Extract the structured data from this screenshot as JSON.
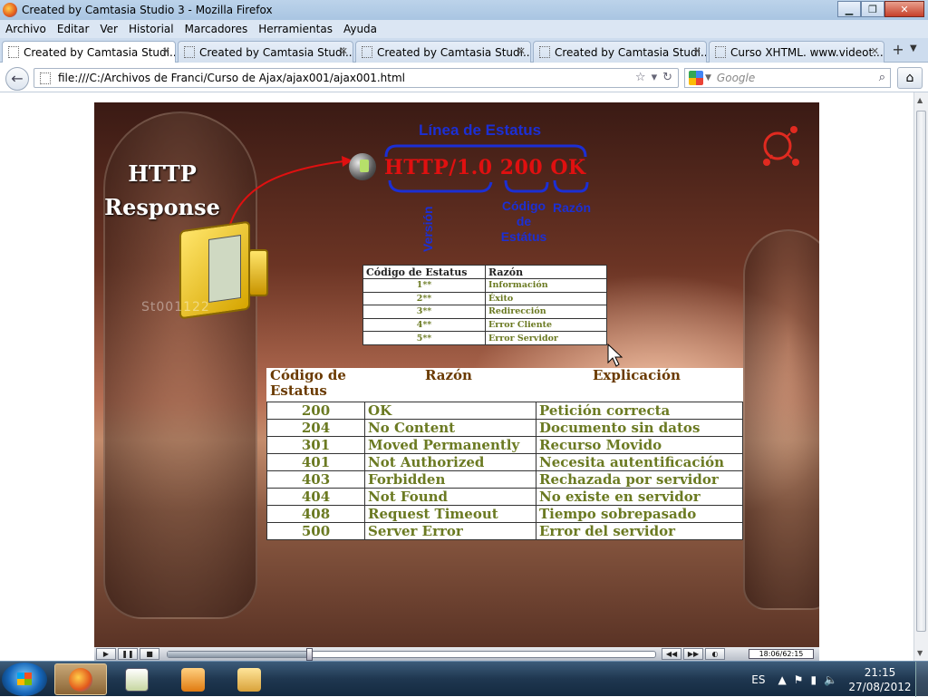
{
  "window": {
    "title": "Created by Camtasia Studio 3 - Mozilla Firefox",
    "minimize": "▁",
    "maximize": "❐",
    "close": "✕"
  },
  "menu": [
    "Archivo",
    "Editar",
    "Ver",
    "Historial",
    "Marcadores",
    "Herramientas",
    "Ayuda"
  ],
  "tabs": [
    {
      "label": "Created by Camtasia Studi...",
      "active": true
    },
    {
      "label": "Created by Camtasia Studi...",
      "active": false
    },
    {
      "label": "Created by Camtasia Studi...",
      "active": false
    },
    {
      "label": "Created by Camtasia Studi...",
      "active": false
    },
    {
      "label": "Curso XHTML. www.videot...",
      "active": false
    }
  ],
  "nav": {
    "url": "file:///C:/Archivos de Franci/Curso de Ajax/ajax001/ajax001.html",
    "search_placeholder": "Google"
  },
  "slide": {
    "title_line1": "HTTP",
    "title_line2": "Response",
    "status_heading": "Línea de Estatus",
    "status_line": "HTTP/1.0 200 OK",
    "label_version": "Versión",
    "label_codigo": "Código de Estátus",
    "label_razon": "Razón",
    "stamp": "St001122",
    "small_table": {
      "headers": [
        "Código de Estatus",
        "Razón"
      ],
      "rows": [
        [
          "1**",
          "Información"
        ],
        [
          "2**",
          "Éxito"
        ],
        [
          "3**",
          "Redirección"
        ],
        [
          "4**",
          "Error Cliente"
        ],
        [
          "5**",
          "Error Servidor"
        ]
      ]
    },
    "big_table": {
      "headers": [
        "Código de Estatus",
        "Razón",
        "Explicación"
      ],
      "rows": [
        [
          "200",
          "OK",
          "Petición correcta"
        ],
        [
          "204",
          "No Content",
          "Documento sin datos"
        ],
        [
          "301",
          "Moved Permanently",
          "Recurso Movido"
        ],
        [
          "401",
          "Not Authorized",
          "Necesita autentificación"
        ],
        [
          "403",
          "Forbidden",
          "Rechazada por servidor"
        ],
        [
          "404",
          "Not Found",
          "No existe en servidor"
        ],
        [
          "408",
          "Request Timeout",
          "Tiempo sobrepasado"
        ],
        [
          "500",
          "Server Error",
          "Error del servidor"
        ]
      ]
    }
  },
  "player": {
    "timecode": "18:06/62:15",
    "progress": 0.29
  },
  "taskbar": {
    "lang": "ES",
    "time": "21:15",
    "date": "27/08/2012"
  },
  "colors": {
    "status_red": "#e01010",
    "label_blue": "#1c2fd4",
    "table_green": "#6b7a22"
  }
}
